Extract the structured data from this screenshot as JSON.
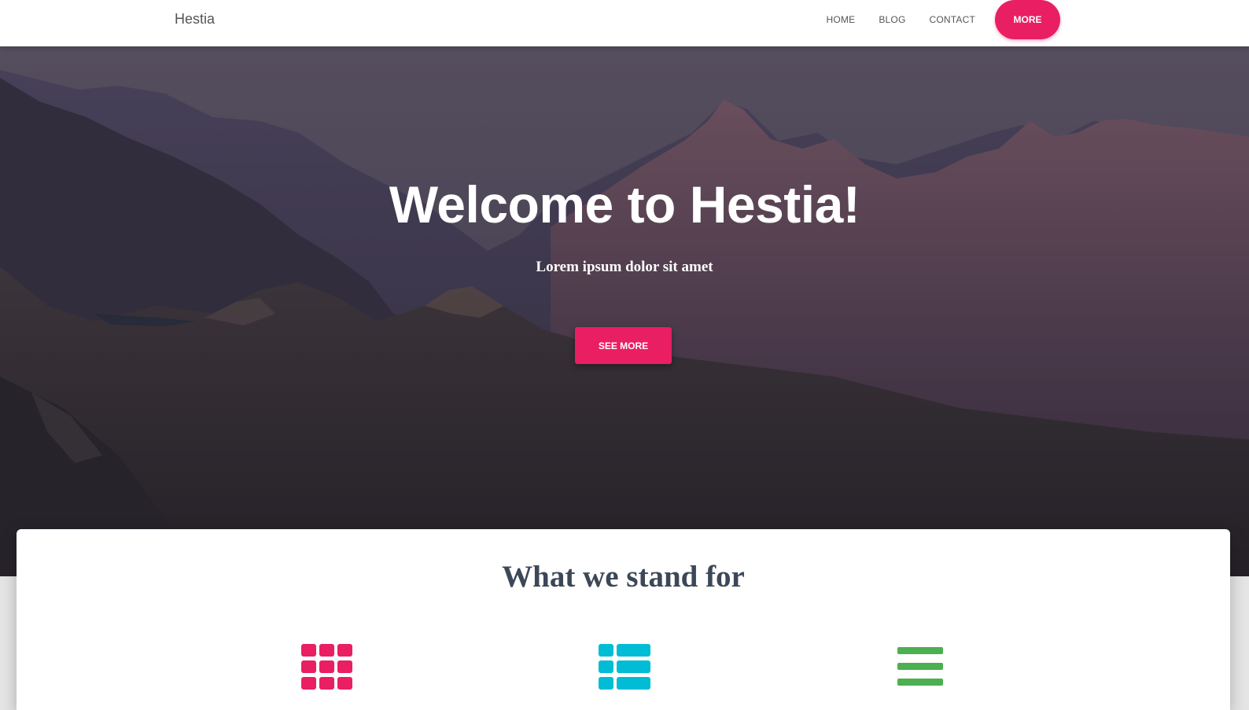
{
  "navbar": {
    "brand": "Hestia",
    "links": [
      "HOME",
      "BLOG",
      "CONTACT"
    ],
    "more_label": "MORE"
  },
  "hero": {
    "title": "Welcome to Hestia!",
    "subtitle": "Lorem ipsum dolor sit amet",
    "button_label": "SEE MORE"
  },
  "features": {
    "title": "What we stand for",
    "icons": [
      "grid-icon",
      "list-view-icon",
      "menu-lines-icon"
    ]
  },
  "colors": {
    "accent": "#e91e63",
    "cyan": "#00bcd4",
    "green": "#4caf50",
    "title_text": "#3c4858"
  }
}
